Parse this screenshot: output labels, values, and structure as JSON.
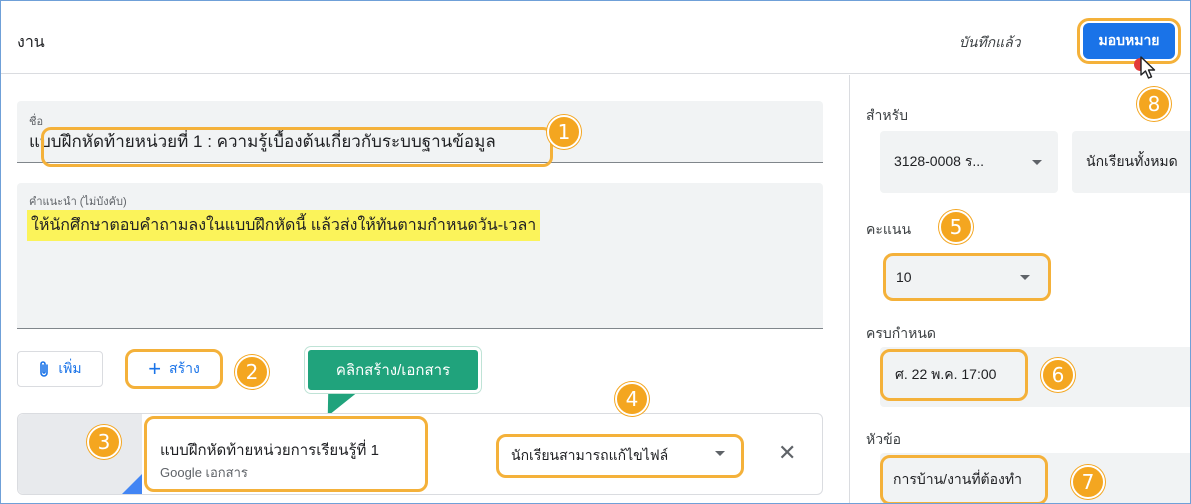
{
  "header": {
    "title": "งาน",
    "saved_status": "บันทึกแล้ว",
    "assign_label": "มอบหมาย"
  },
  "form": {
    "title_label": "ชื่อ",
    "title_value": "แบบฝึกหัดท้ายหน่วยที่ 1 : ความรู้เบื้องต้นเกี่ยวกับระบบฐานข้อมูล",
    "instructions_label": "คำแนะนำ (ไม่บังคับ)",
    "instructions_value": "ให้นักศึกษาตอบคำถามลงในแบบฝึกหัดนี้ แล้วส่งให้ทันตามกำหนดวัน-เวลา"
  },
  "toolbar": {
    "add_label": "เพิ่ม",
    "create_label": "สร้าง"
  },
  "callout": {
    "text": "คลิกสร้าง/เอกสาร"
  },
  "attachment": {
    "title": "แบบฝึกหัดท้ายหน่วยการเรียนรู้ที่ 1",
    "type": "Google เอกสาร",
    "permission": "นักเรียนสามารถแก้ไขไฟล์"
  },
  "sidebar": {
    "for_label": "สำหรับ",
    "class_value": "3128-0008 ร...",
    "students_value": "นักเรียนทั้งหมด",
    "points_label": "คะแนน",
    "points_value": "10",
    "due_label": "ครบกำหนด",
    "due_value": "ศ. 22 พ.ค. 17:00",
    "topic_label": "หัวข้อ",
    "topic_value": "การบ้าน/งานที่ต้องทำ"
  },
  "badges": {
    "b1": "1",
    "b2": "2",
    "b3": "3",
    "b4": "4",
    "b5": "5",
    "b6": "6",
    "b7": "7",
    "b8": "8"
  },
  "colors": {
    "accent": "#1a73e8",
    "highlight_outline": "#f4b13a",
    "badge": "#f4a620",
    "callout": "#20a37c",
    "text_highlight": "#fbf35a"
  },
  "icons": {
    "attach": "paperclip-icon",
    "create": "plus-icon",
    "close": "close-icon",
    "dropdown": "chevron-down-icon",
    "cursor": "mouse-pointer-icon"
  }
}
